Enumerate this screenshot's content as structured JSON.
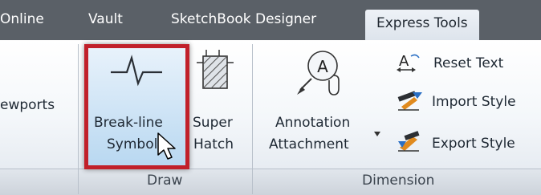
{
  "tabs": [
    {
      "label": "Online",
      "active": false
    },
    {
      "label": "Vault",
      "active": false
    },
    {
      "label": "SketchBook Designer",
      "active": false
    },
    {
      "label": "Express Tools",
      "active": true
    }
  ],
  "viewports": {
    "label": "ewports"
  },
  "breakline": {
    "line1": "Break-line",
    "line2": "Symbol"
  },
  "superhatch": {
    "line1": "Super",
    "line2": "Hatch"
  },
  "annotation": {
    "line1": "Annotation",
    "line2": "Attachment"
  },
  "tools": {
    "reset_text": "Reset Text",
    "import_style": "Import Style",
    "export_style": "Export Style"
  },
  "panels": {
    "draw": "Draw",
    "dimension": "Dimension"
  },
  "colors": {
    "highlight_border": "#c1202a",
    "tab_bar": "#5a6067",
    "hover_fill": "#b9d8f1"
  }
}
